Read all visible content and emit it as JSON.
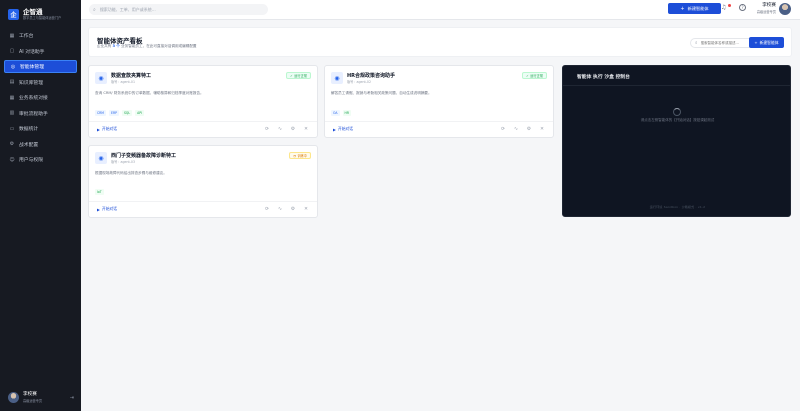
{
  "brand": {
    "name": "企智通",
    "subtitle": "数字员工与智能体运营门户"
  },
  "sidebar": {
    "items": [
      {
        "icon": "▦",
        "label": "工作台"
      },
      {
        "icon": "▢",
        "label": "AI 对话助手"
      },
      {
        "icon": "◎",
        "label": "智能体管理"
      },
      {
        "icon": "▤",
        "label": "知识库管理"
      },
      {
        "icon": "▦",
        "label": "业务系统对接"
      },
      {
        "icon": "▥",
        "label": "审批流程助手"
      },
      {
        "icon": "▭",
        "label": "数据统计"
      },
      {
        "icon": "⚙",
        "label": "战术配置"
      },
      {
        "icon": "☺",
        "label": "用户与权限"
      }
    ],
    "active_index": 2
  },
  "sidebar_user": {
    "name": "李校赛",
    "role": "高级运营专员"
  },
  "topbar": {
    "search_placeholder": "搜索功能、工单、用户或系统…",
    "new_button": "新建智能体",
    "user_name": "李校赛",
    "user_role": "高级运营专员"
  },
  "header": {
    "title": "智能体资产看板",
    "sub_prefix": "企业共有",
    "count": "3 个",
    "sub_suffix": "业务智能员工，在此可直接对话调用或编辑配置",
    "search_placeholder": "搜索智能体名称或描述…",
    "new_button": "新建智能体"
  },
  "cards": [
    {
      "title": "数据查款夹算特工",
      "meta": "版号：agent-01",
      "status": "运行正常",
      "status_type": "on",
      "desc": "查询 CRM/ 财务系统中的订单数据，辅助核算和归档季度对账报告。",
      "tags": [
        {
          "label": "CRM",
          "color": "blue"
        },
        {
          "label": "ERP",
          "color": "blue"
        },
        {
          "label": "SQL",
          "color": "green"
        },
        {
          "label": "API",
          "color": "green"
        }
      ],
      "open_label": "开始对话"
    },
    {
      "title": "HR合规政策咨询助手",
      "meta": "版号：agent-02",
      "status": "运行正常",
      "status_type": "on",
      "desc": "解答员工请假、报销与考勤相关政策问题，自动生成说明摘要。",
      "tags": [
        {
          "label": "OA",
          "color": "blue"
        },
        {
          "label": "HR",
          "color": "green"
        }
      ],
      "open_label": "开始对话"
    },
    {
      "title": "西门子变频器备故障诊断特工",
      "meta": "版号：agent-03",
      "status": "训练中",
      "status_type": "train",
      "desc": "根据现场故障代码给出排查步骤与维修建议。",
      "tags": [
        {
          "label": "IoT",
          "color": "green"
        }
      ],
      "open_label": "开始对话"
    }
  ],
  "console": {
    "title": "智能体 执行 沙盒 控制台",
    "message": "请点击左侧智能体的【开始对话】按钮调起测试",
    "footer": "运行环境 Sandbox  ·  沙箱模式  ·  v1.2"
  },
  "colors": {
    "accent": "#1d4ed8",
    "sidebar_bg": "#171a22",
    "console_bg": "#0f1522"
  }
}
